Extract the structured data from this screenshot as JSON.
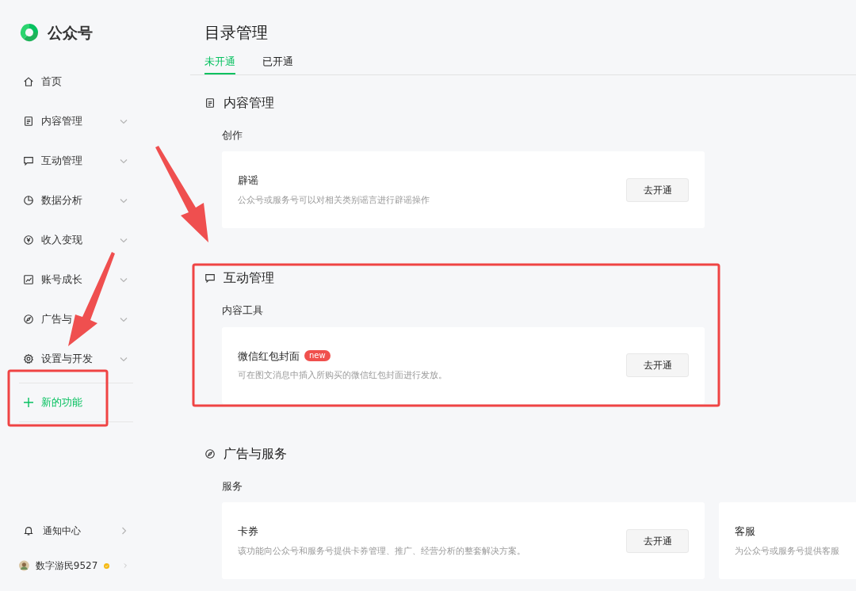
{
  "brand": {
    "name": "公众号"
  },
  "sidebar": {
    "items": [
      {
        "label": "首页",
        "expandable": false
      },
      {
        "label": "内容管理",
        "expandable": true
      },
      {
        "label": "互动管理",
        "expandable": true
      },
      {
        "label": "数据分析",
        "expandable": true
      },
      {
        "label": "收入变现",
        "expandable": true
      },
      {
        "label": "账号成长",
        "expandable": true
      },
      {
        "label": "广告与",
        "expandable": true
      },
      {
        "label": "设置与开发",
        "expandable": true
      }
    ],
    "new_feature": "新的功能",
    "bottom": [
      {
        "kind": "notice",
        "label": "通知中心"
      },
      {
        "kind": "user",
        "label": "数字游民9527"
      }
    ]
  },
  "page": {
    "title": "目录管理",
    "tabs": [
      {
        "label": "未开通",
        "selected": true
      },
      {
        "label": "已开通",
        "selected": false
      }
    ]
  },
  "sections": [
    {
      "title": "内容管理",
      "groups": [
        {
          "title": "创作",
          "cards": [
            {
              "name": "辟谣",
              "description": "公众号或服务号可以对相关类别谣言进行辟谣操作",
              "button": "去开通"
            }
          ]
        }
      ]
    },
    {
      "title": "互动管理",
      "groups": [
        {
          "title": "内容工具",
          "cards": [
            {
              "name": "微信红包封面",
              "badge": "new",
              "description": "可在图文消息中插入所购买的微信红包封面进行发放。",
              "button": "去开通"
            }
          ]
        }
      ]
    },
    {
      "title": "广告与服务",
      "groups": [
        {
          "title": "服务",
          "cards": [
            {
              "name": "卡券",
              "description": "该功能向公众号和服务号提供卡券管理、推广、经营分析的整套解决方案。",
              "button": "去开通"
            },
            {
              "name": "客服",
              "description": "为公众号或服务号提供客服"
            }
          ]
        }
      ]
    }
  ]
}
